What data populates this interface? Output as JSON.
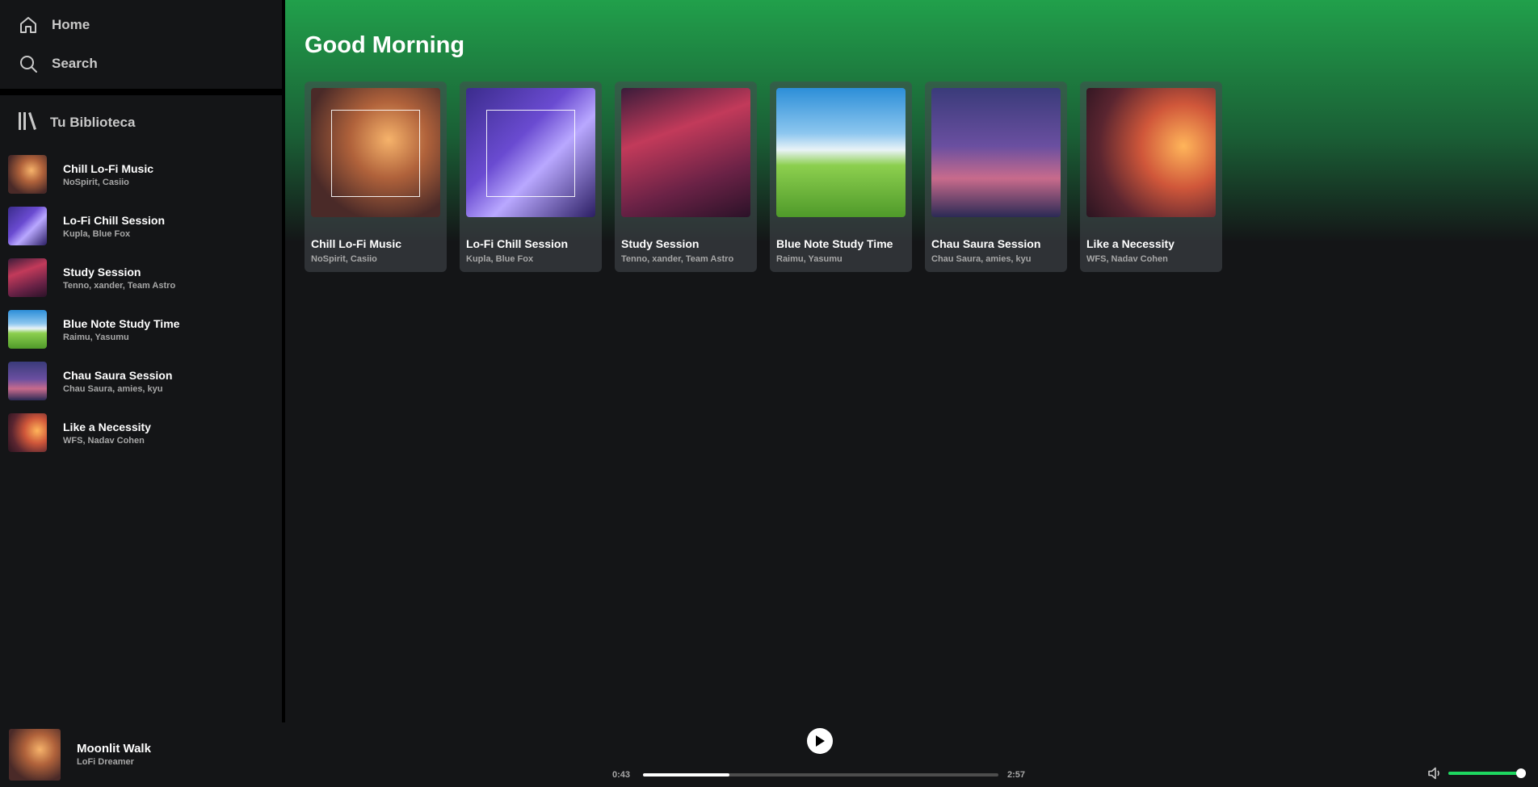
{
  "nav": {
    "home": {
      "label": "Home",
      "icon": "home-icon"
    },
    "search": {
      "label": "Search",
      "icon": "search-icon"
    }
  },
  "library": {
    "label": "Tu Biblioteca",
    "icon": "library-icon",
    "items": [
      {
        "title": "Chill Lo-Fi Music",
        "artists": "NoSpirit, Casiio"
      },
      {
        "title": "Lo-Fi Chill Session",
        "artists": "Kupla, Blue Fox"
      },
      {
        "title": "Study Session",
        "artists": "Tenno, xander, Team Astro"
      },
      {
        "title": "Blue Note Study Time",
        "artists": "Raimu, Yasumu"
      },
      {
        "title": "Chau Saura Session",
        "artists": "Chau Saura, amies, kyu"
      },
      {
        "title": "Like a Necessity",
        "artists": "WFS, Nadav Cohen"
      }
    ]
  },
  "main": {
    "greeting": "Good Morning",
    "cards": [
      {
        "title": "Chill Lo-Fi Music",
        "artists": "NoSpirit, Casiio"
      },
      {
        "title": "Lo-Fi Chill Session",
        "artists": "Kupla, Blue Fox"
      },
      {
        "title": "Study Session",
        "artists": "Tenno, xander, Team Astro"
      },
      {
        "title": "Blue Note Study Time",
        "artists": "Raimu, Yasumu"
      },
      {
        "title": "Chau Saura Session",
        "artists": "Chau Saura, amies, kyu"
      },
      {
        "title": "Like a Necessity",
        "artists": "WFS, Nadav Cohen"
      }
    ]
  },
  "player": {
    "track_title": "Moonlit Walk",
    "track_artist": "LoFi Dreamer",
    "current_time": "0:43",
    "total_time": "2:57",
    "progress_fraction": 0.243,
    "volume_fraction": 1.0,
    "play_icon": "play-icon",
    "volume_icon": "volume-icon",
    "accent_color": "#1ed760"
  }
}
